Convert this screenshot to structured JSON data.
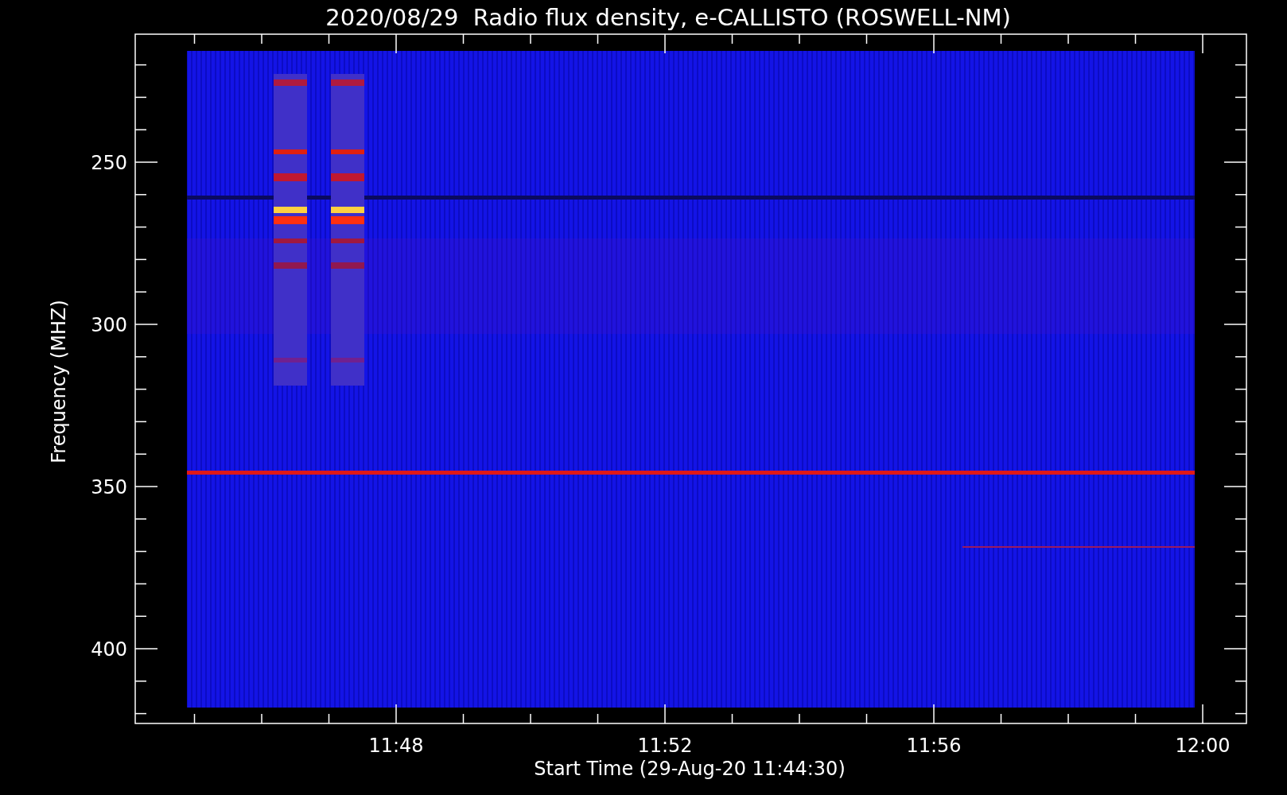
{
  "title": "2020/08/29  Radio flux density, e-CALLISTO (ROSWELL-NM)",
  "y_axis": {
    "label": "Frequency (MHZ)",
    "ticks": [
      "250",
      "300",
      "350",
      "400"
    ]
  },
  "x_axis": {
    "label": "Start Time (29-Aug-20 11:44:30)",
    "ticks": [
      "11:48",
      "11:52",
      "11:56",
      "12:00"
    ]
  }
}
